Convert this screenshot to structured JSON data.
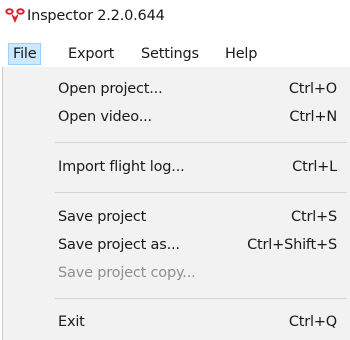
{
  "window": {
    "title": "Inspector 2.2.0.644",
    "icon": "drone-logo-icon",
    "accent_color": "#e0202a"
  },
  "menubar": {
    "items": [
      {
        "label": "File",
        "active": true
      },
      {
        "label": "Export"
      },
      {
        "label": "Settings"
      },
      {
        "label": "Help"
      }
    ]
  },
  "file_menu": {
    "items": [
      {
        "label": "Open project...",
        "shortcut": "Ctrl+O",
        "enabled": true
      },
      {
        "label": "Open video...",
        "shortcut": "Ctrl+N",
        "enabled": true
      },
      {
        "label": "Import flight log...",
        "shortcut": "Ctrl+L",
        "enabled": true
      },
      {
        "label": "Save project",
        "shortcut": "Ctrl+S",
        "enabled": true
      },
      {
        "label": "Save project as...",
        "shortcut": "Ctrl+Shift+S",
        "enabled": true
      },
      {
        "label": "Save project copy...",
        "shortcut": "",
        "enabled": false
      },
      {
        "label": "Exit",
        "shortcut": "Ctrl+Q",
        "enabled": true
      }
    ]
  },
  "colors": {
    "menu_highlight": "#cce8ff",
    "menu_highlight_border": "#99d1ff",
    "dropdown_bg": "#f2f2f2",
    "disabled_text": "#8f8f8f"
  }
}
